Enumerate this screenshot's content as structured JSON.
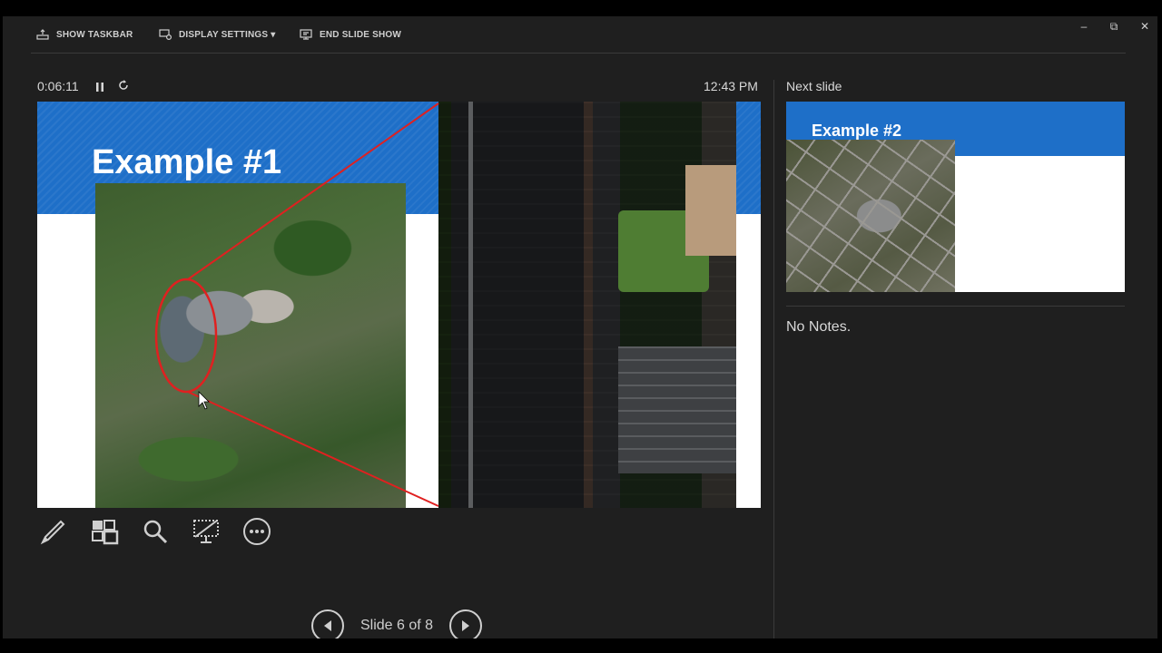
{
  "toolbar": {
    "show_taskbar": "SHOW TASKBAR",
    "display_settings": "DISPLAY SETTINGS ▾",
    "end_slide_show": "END SLIDE SHOW"
  },
  "window_controls": {
    "minimize": "–",
    "restore": "⧉",
    "close": "✕"
  },
  "presenter": {
    "elapsed_time": "0:06:11",
    "clock": "12:43 PM"
  },
  "current_slide": {
    "title": "Example #1"
  },
  "navigation": {
    "counter": "Slide 6 of 8"
  },
  "next_slide": {
    "label": "Next slide",
    "title": "Example #2"
  },
  "notes": {
    "text": "No Notes."
  },
  "colors": {
    "slide_accent": "#1e6fc8",
    "annotation": "#e02020",
    "background": "#1f1f1f"
  }
}
